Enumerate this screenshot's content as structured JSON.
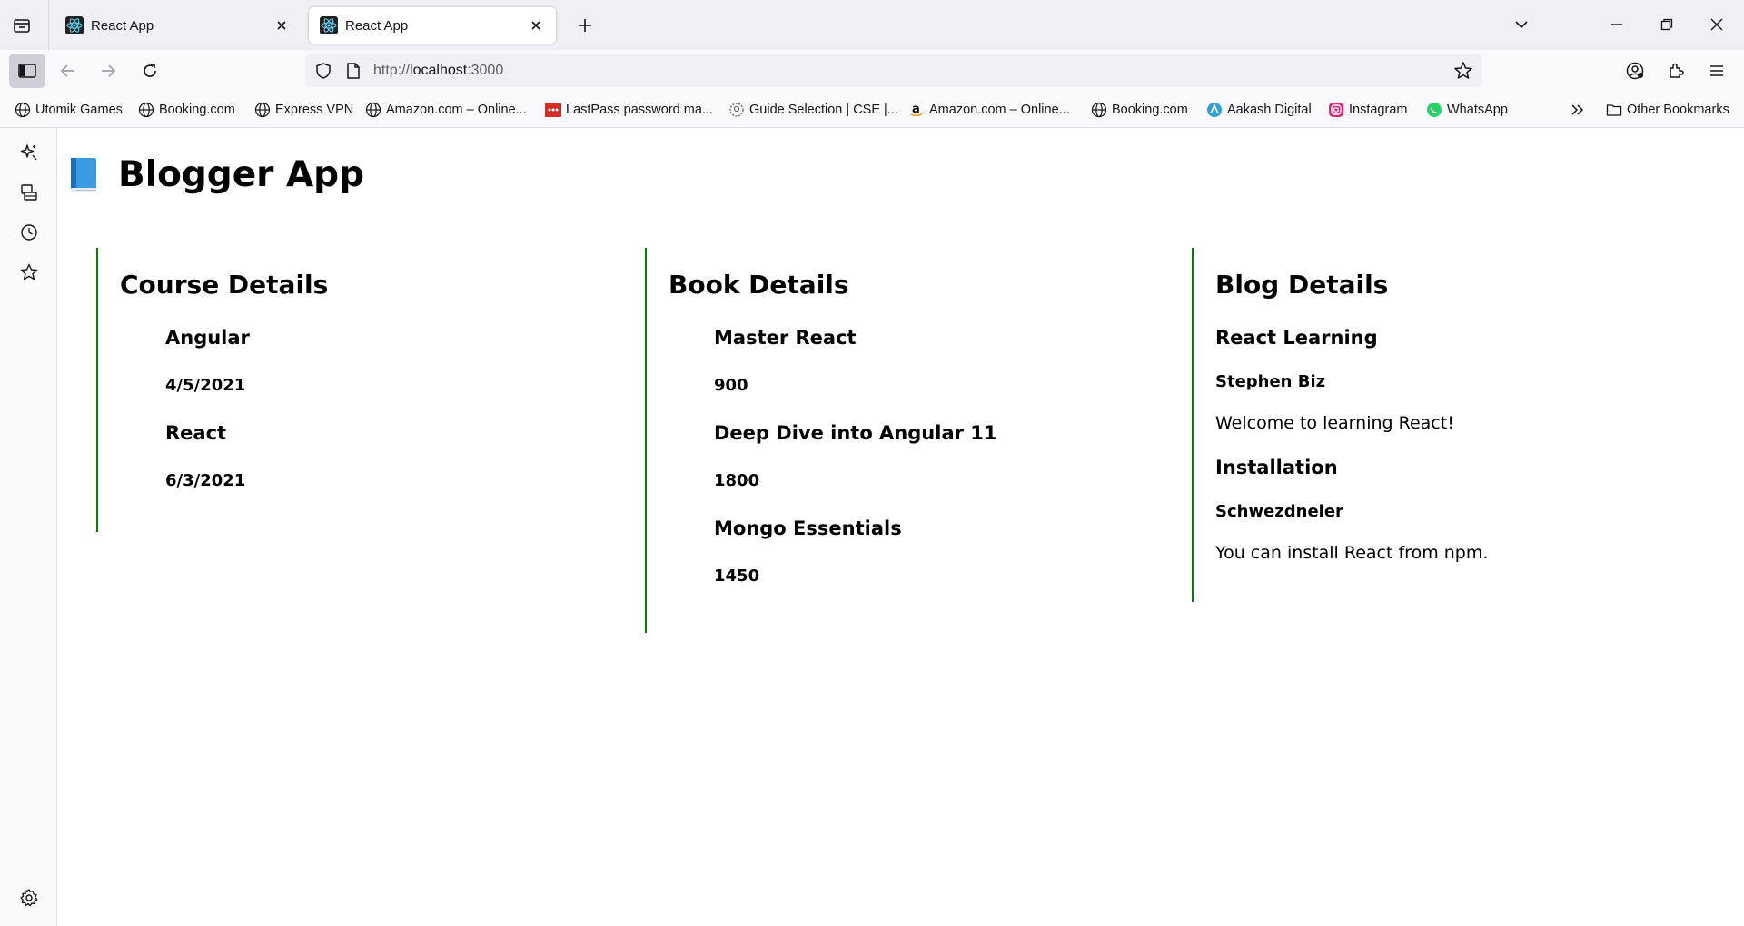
{
  "browser": {
    "tabs": [
      {
        "title": "React App",
        "active": false
      },
      {
        "title": "React App",
        "active": true
      }
    ],
    "url": {
      "scheme": "http://",
      "host": "localhost",
      "port": ":3000"
    },
    "bookmarks": [
      {
        "label": "Utomik Games",
        "icon": "globe-icon"
      },
      {
        "label": "Booking.com",
        "icon": "globe-icon"
      },
      {
        "label": "Express VPN",
        "icon": "globe-icon"
      },
      {
        "label": "Amazon.com – Online...",
        "icon": "globe-icon"
      },
      {
        "label": "LastPass password ma...",
        "icon": "lastpass-icon"
      },
      {
        "label": "Guide Selection | CSE |...",
        "icon": "guide-icon"
      },
      {
        "label": "Amazon.com – Online...",
        "icon": "amazon-icon"
      },
      {
        "label": "Booking.com",
        "icon": "globe-icon"
      },
      {
        "label": "Aakash Digital",
        "icon": "aakash-icon"
      },
      {
        "label": "Instagram",
        "icon": "instagram-icon"
      },
      {
        "label": "WhatsApp",
        "icon": "whatsapp-icon"
      }
    ],
    "other_bookmarks": "Other Bookmarks",
    "colors": {
      "tabstrip": "#f0f0f4",
      "toolbar": "#f9f9fb",
      "accent_green": "#008000"
    }
  },
  "page": {
    "title": "Blogger App",
    "courses": {
      "heading": "Course Details",
      "items": [
        {
          "name": "Angular",
          "date": "4/5/2021"
        },
        {
          "name": "React",
          "date": "6/3/2021"
        }
      ]
    },
    "books": {
      "heading": "Book Details",
      "items": [
        {
          "name": "Master React",
          "price": "900"
        },
        {
          "name": "Deep Dive into Angular 11",
          "price": "1800"
        },
        {
          "name": "Mongo Essentials",
          "price": "1450"
        }
      ]
    },
    "blogs": {
      "heading": "Blog Details",
      "items": [
        {
          "title": "React Learning",
          "author": "Stephen Biz",
          "text": "Welcome to learning React!"
        },
        {
          "title": "Installation",
          "author": "Schwezdneier",
          "text": "You can install React from npm."
        }
      ]
    }
  }
}
